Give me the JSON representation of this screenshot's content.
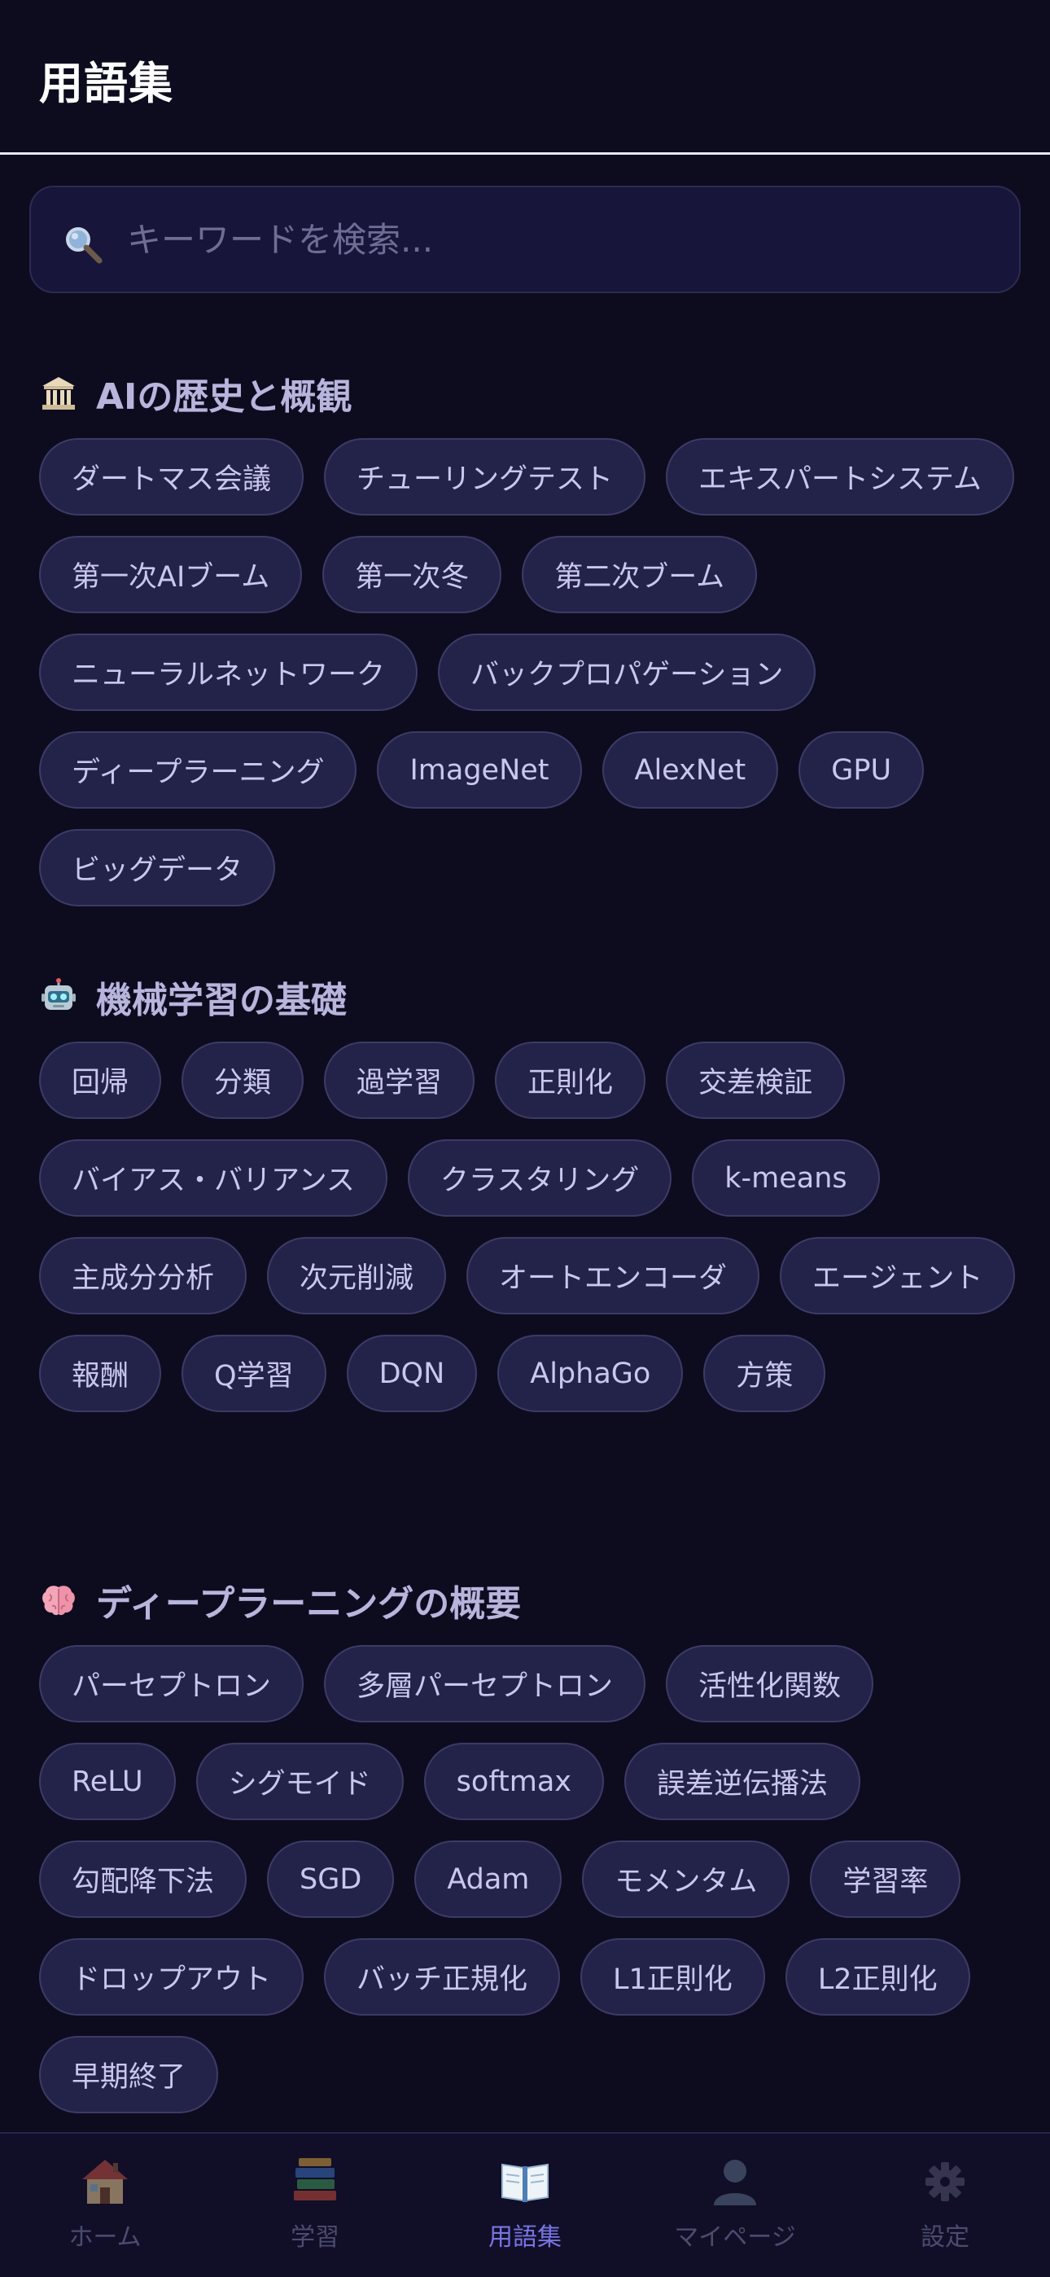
{
  "header": {
    "title": "用語集"
  },
  "search": {
    "placeholder": "キーワードを検索..."
  },
  "sections": [
    {
      "title": "AIの歴史と概観",
      "icon": "museum-icon",
      "terms": [
        "ダートマス会議",
        "チューリングテスト",
        "エキスパートシステム",
        "第一次AIブーム",
        "第一次冬",
        "第二次ブーム",
        "ニューラルネットワーク",
        "バックプロパゲーション",
        "ディープラーニング",
        "ImageNet",
        "AlexNet",
        "GPU",
        "ビッグデータ"
      ]
    },
    {
      "title": "機械学習の基礎",
      "icon": "robot-icon",
      "terms": [
        "回帰",
        "分類",
        "過学習",
        "正則化",
        "交差検証",
        "バイアス・バリアンス",
        "クラスタリング",
        "k-means",
        "主成分分析",
        "次元削減",
        "オートエンコーダ",
        "エージェント",
        "報酬",
        "Q学習",
        "DQN",
        "AlphaGo",
        "方策"
      ]
    },
    {
      "title": "ディープラーニングの概要",
      "icon": "brain-icon",
      "terms": [
        "パーセプトロン",
        "多層パーセプトロン",
        "活性化関数",
        "ReLU",
        "シグモイド",
        "softmax",
        "誤差逆伝播法",
        "勾配降下法",
        "SGD",
        "Adam",
        "モメンタム",
        "学習率",
        "ドロップアウト",
        "バッチ正規化",
        "L1正則化",
        "L2正則化",
        "早期終了"
      ]
    }
  ],
  "nav": {
    "items": [
      {
        "label": "ホーム",
        "icon": "house-icon"
      },
      {
        "label": "学習",
        "icon": "books-icon"
      },
      {
        "label": "用語集",
        "icon": "open-book-icon",
        "active": true
      },
      {
        "label": "マイページ",
        "icon": "user-icon"
      },
      {
        "label": "設定",
        "icon": "gear-icon"
      }
    ]
  },
  "colors": {
    "background": "#0d0c1f",
    "chip": "#232248",
    "chip_border": "#3c3b66",
    "accent": "#7a74e6"
  }
}
